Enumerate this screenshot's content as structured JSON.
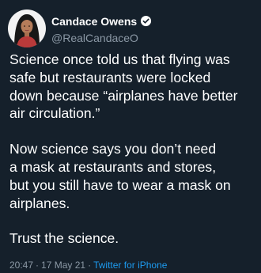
{
  "author": {
    "display_name": "Candace Owens",
    "handle": "@RealCandaceO",
    "verified_icon": "verified-badge-icon"
  },
  "tweet": {
    "paragraphs": [
      {
        "lines": [
          "Science once told us that flying was",
          "safe but restaurants were locked",
          "down because “airplanes have better",
          "air circulation.”"
        ]
      },
      {
        "lines": [
          "Now science says you don’t need",
          "a mask at restaurants and stores,",
          "but you still have to wear a mask on",
          "airplanes."
        ]
      },
      {
        "lines": [
          "Trust the science."
        ]
      }
    ]
  },
  "meta": {
    "time": "20:47",
    "separator": "·",
    "date": "17 May 21",
    "source": "Twitter for iPhone"
  },
  "colors": {
    "background": "#15202b",
    "text": "#ffffff",
    "secondary": "#8b98a5",
    "link": "#1d9bf0"
  }
}
